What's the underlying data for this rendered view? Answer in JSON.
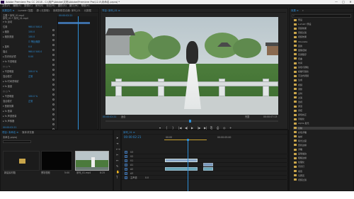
{
  "window": {
    "title": "Adobe Premiere Pro CC 2018 - C:\\用户\\Adobe\\文档\\Adobe\\Premiere Pro\\12.0\\未命名.prproj *",
    "controls": [
      "—",
      "□",
      "✕"
    ]
  },
  "menu": [
    "文件(F)",
    "编辑(E)",
    "剪辑(C)",
    "序列(S)",
    "标记(M)",
    "图形(G)",
    "窗口(W)",
    "帮助(H)"
  ],
  "source_tabs": [
    "效果控件 ≡",
    "Lumetri 范围",
    "源: (无剪辑)",
    "音频剪辑混合器: 序列_01",
    "元数据"
  ],
  "effect_controls": {
    "header": "主要 * 序列_01.mp4",
    "sequence_label": "序列_01 * 序列_01.mp4",
    "timecode": "00:00:02:21",
    "rows": [
      {
        "label": "▾ fx 运动",
        "value": ""
      },
      {
        "label": "   位置",
        "value": "960.0  540.0"
      },
      {
        "label": "  ▸ 缩放",
        "value": "100.0"
      },
      {
        "label": "  ▸ 缩放宽度",
        "value": "100.0"
      },
      {
        "label": "",
        "value": "☑ 等比缩放"
      },
      {
        "label": "  ▸ 旋转",
        "value": "0.0"
      },
      {
        "label": "   锚点",
        "value": "960.0  540.0"
      },
      {
        "label": "  ▸ 防闪烁滤镜",
        "value": "0.00"
      },
      {
        "label": "▾ fx 不透明度",
        "value": ""
      },
      {
        "label": "   ○ □ ✎",
        "value": ""
      },
      {
        "label": "  ▸ 不透明度",
        "value": "100.0 %"
      },
      {
        "label": "   混合模式",
        "value": "正常"
      },
      {
        "label": "▸ fx 时间重映射",
        "value": ""
      },
      {
        "label": "▾ fx 速度",
        "value": ""
      },
      {
        "label": "   ○ □ ✎",
        "value": ""
      },
      {
        "label": "  ▸ 不透明度",
        "value": "100.0 %"
      },
      {
        "label": "   混合模式",
        "value": "正常"
      },
      {
        "label": "▾ 音频效果",
        "value": ""
      },
      {
        "label": " ▸ fx 音量",
        "value": ""
      },
      {
        "label": " ▸ fx 声道音量",
        "value": ""
      },
      {
        "label": " ▸ fx 声像器",
        "value": ""
      }
    ],
    "footer_timecode": "00:00:02:21"
  },
  "program_tabs": [
    "节目: 序列_01 ≡"
  ],
  "program": {
    "timecode_left": "00:00:02:21",
    "fit_label": "适合",
    "quality_label": "完整",
    "timecode_right": "00:00:07:13",
    "transport": [
      "▾",
      "{",
      "}",
      "|◀",
      "◀|",
      "▶",
      "|▶",
      "▶|",
      "⎘",
      "⎙",
      "◎",
      "+"
    ]
  },
  "effects_panel": {
    "tabs": [
      "效果 ≡",
      "»"
    ],
    "search_placeholder": "",
    "items": [
      {
        "label": "预设",
        "selected": false
      },
      {
        "label": "Lumetri 预设",
        "selected": false
      },
      {
        "label": "音频效果",
        "selected": false
      },
      {
        "label": "音频过渡",
        "selected": false
      },
      {
        "label": "视频效果",
        "selected": false
      },
      {
        "label": "Obsolete",
        "selected": false
      },
      {
        "label": "变换",
        "selected": false
      },
      {
        "label": "图像控制",
        "selected": false
      },
      {
        "label": "实用程序",
        "selected": false
      },
      {
        "label": "扭曲",
        "selected": false
      },
      {
        "label": "时间",
        "selected": false
      },
      {
        "label": "杂色与颗粒",
        "selected": false
      },
      {
        "label": "模糊与锐化",
        "selected": false
      },
      {
        "label": "沉浸式视频",
        "selected": false
      },
      {
        "label": "生成",
        "selected": false
      },
      {
        "label": "视频",
        "selected": false
      },
      {
        "label": "调整",
        "selected": false
      },
      {
        "label": "过时",
        "selected": false
      },
      {
        "label": "过渡",
        "selected": false
      },
      {
        "label": "透视",
        "selected": false
      },
      {
        "label": "通道",
        "selected": false
      },
      {
        "label": "键控",
        "selected": false
      },
      {
        "label": "颜色校正",
        "selected": false
      },
      {
        "label": "风格化",
        "selected": false
      },
      {
        "label": "Alpha 发光",
        "selected": false
      },
      {
        "label": "复制",
        "selected": true
      },
      {
        "label": "彩色浮雕",
        "selected": false
      },
      {
        "label": "抽帧",
        "selected": false
      },
      {
        "label": "曝光过度",
        "selected": false
      },
      {
        "label": "查找边缘",
        "selected": false
      },
      {
        "label": "浮雕",
        "selected": false
      },
      {
        "label": "画笔描边",
        "selected": false
      },
      {
        "label": "粗糙边缘",
        "selected": false
      },
      {
        "label": "纹理化",
        "selected": false
      },
      {
        "label": "闪光灯",
        "selected": false
      },
      {
        "label": "阈值",
        "selected": false
      },
      {
        "label": "马赛克",
        "selected": false
      },
      {
        "label": "视频过渡",
        "selected": false
      }
    ]
  },
  "project_panel": {
    "tabs": [
      "项目: 未命名 ≡",
      "媒体浏览器"
    ],
    "project_file": "未命名.prproj",
    "items": [
      {
        "label": "新建素材箱",
        "meta": "",
        "type": "folder"
      },
      {
        "label": "黑场视频",
        "meta": "5:00",
        "type": "black"
      },
      {
        "label": "序列_01.mp4",
        "meta": "8:25",
        "type": "video"
      }
    ]
  },
  "timeline": {
    "tab": "序列_01 ≡",
    "timecode": "00:00:02:21",
    "ruler": [
      "00:00",
      "00:00:05:00"
    ],
    "tracks": [
      "V3",
      "V2",
      "V1",
      "A1",
      "A2",
      "A3",
      "主声道"
    ],
    "master_value": "0.0"
  },
  "colors": {
    "accent": "#2e8fd8",
    "panel": "#1e1e1e",
    "clip_video": "#8aa6c8",
    "clip_audio": "#6aa6b8",
    "timecode": "#2e8fd8"
  }
}
